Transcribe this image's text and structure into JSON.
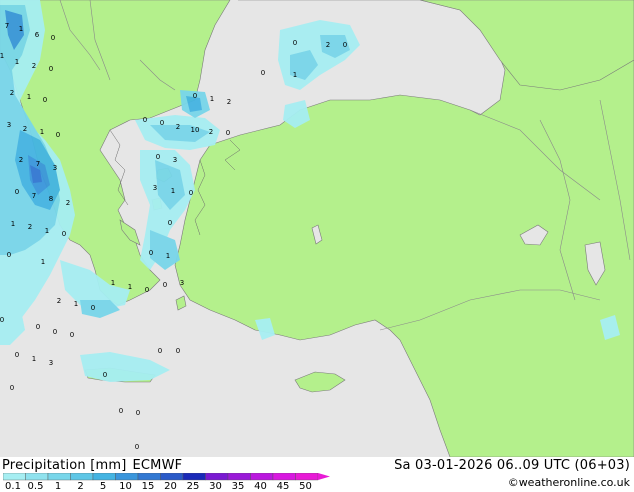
{
  "header": {
    "title": "Precipitation [mm]",
    "model": "ECMWF",
    "datetime": "Sa 03-01-2026 06..09 UTC (06+03)",
    "copyright": "©weatheronline.co.uk"
  },
  "legend": {
    "labels": [
      "0.1",
      "0.5",
      "1",
      "2",
      "5",
      "10",
      "15",
      "20",
      "25",
      "30",
      "35",
      "40",
      "45",
      "50"
    ],
    "colors": [
      "#a6eef2",
      "#8fe2ee",
      "#78d6ea",
      "#5ec6e6",
      "#44b4e2",
      "#3a96dc",
      "#3278d2",
      "#2a5ac8",
      "#1a2ab8",
      "#7a1ad2",
      "#9a1ad8",
      "#ba18de",
      "#d818e0",
      "#e81ad6"
    ]
  },
  "map": {
    "land_color": "#b4f08c",
    "sea_color": "#e6e6e6",
    "values": [
      "7",
      "1",
      "6",
      "0",
      "1",
      "1",
      "2",
      "0",
      "2",
      "1",
      "0",
      "3",
      "2",
      "1",
      "0",
      "2",
      "7",
      "3",
      "0",
      "7",
      "8",
      "2",
      "1",
      "2",
      "1",
      "0",
      "0",
      "1",
      "2",
      "1",
      "0",
      "1",
      "1",
      "0",
      "0",
      "0",
      "0",
      "0",
      "0",
      "1",
      "3",
      "0",
      "0",
      "0",
      "1",
      "2",
      "2",
      "10",
      "2",
      "0",
      "3",
      "0",
      "0",
      "0",
      "2",
      "0",
      "1",
      "3",
      "1",
      "0",
      "0",
      "0",
      "1",
      "3",
      "0",
      "0",
      "0",
      "0",
      "0",
      "0",
      "0",
      "0"
    ]
  }
}
